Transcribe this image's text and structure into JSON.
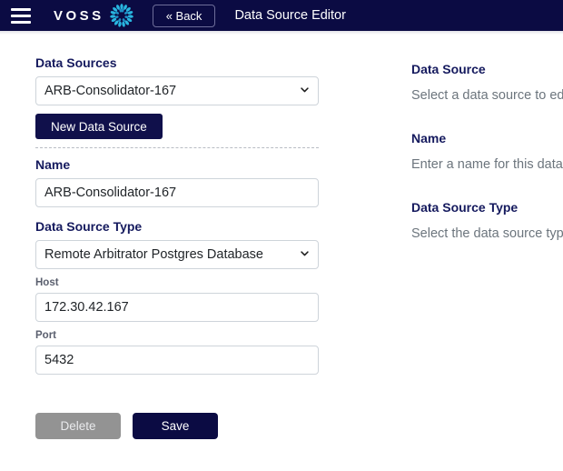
{
  "header": {
    "menu_icon": "hamburger-menu-icon",
    "brand_word": "VOSS",
    "logo_icon": "voss-radial-logo-icon",
    "back_label": "« Back",
    "page_title": "Data Source Editor"
  },
  "form": {
    "data_sources": {
      "label": "Data Sources",
      "selected": "ARB-Consolidator-167",
      "options": [
        "ARB-Consolidator-167"
      ],
      "chevron_icon": "chevron-down-icon"
    },
    "new_data_source_label": "New Data Source",
    "name": {
      "label": "Name",
      "value": "ARB-Consolidator-167",
      "placeholder": ""
    },
    "data_source_type": {
      "label": "Data Source Type",
      "selected": "Remote Arbitrator Postgres Database",
      "options": [
        "Remote Arbitrator Postgres Database"
      ],
      "chevron_icon": "chevron-down-icon"
    },
    "host": {
      "label": "Host",
      "value": "172.30.42.167",
      "placeholder": ""
    },
    "port": {
      "label": "Port",
      "value": "5432",
      "placeholder": ""
    }
  },
  "actions": {
    "delete_label": "Delete",
    "save_label": "Save"
  },
  "help": {
    "blocks": [
      {
        "title": "Data Source",
        "text": "Select a data source to ed"
      },
      {
        "title": "Name",
        "text": "Enter a name for this data"
      },
      {
        "title": "Data Source Type",
        "text": "Select the data source typ"
      }
    ]
  },
  "colors": {
    "navy": "#0b0b43",
    "button_navy": "#10104b",
    "logo_cyan": "#29b6e0",
    "label_navy": "#151a5e",
    "muted_gray": "#6c757d",
    "disabled_gray": "#939393",
    "border_gray": "#ced4da"
  }
}
